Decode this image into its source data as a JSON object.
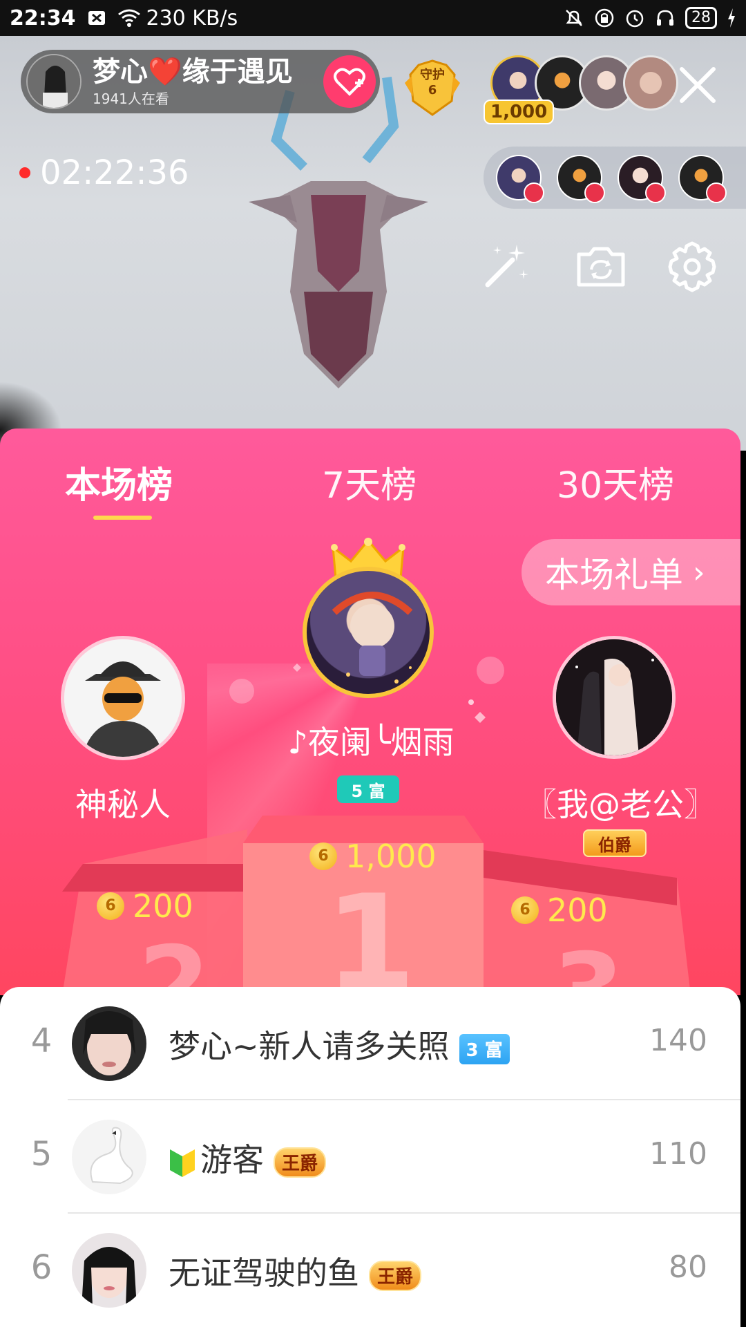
{
  "status_bar": {
    "time": "22:34",
    "network_speed": "230 KB/s",
    "battery": "28"
  },
  "live": {
    "host_name": "梦心❤️缘于遇见",
    "viewers_text": "1941人在看",
    "guard_label": "守护",
    "guard_count": "6",
    "top_viewer_count": "1,000",
    "timer": "02:22:36"
  },
  "ranking": {
    "tabs": [
      {
        "label": "本场榜",
        "active": true
      },
      {
        "label": "7天榜",
        "active": false
      },
      {
        "label": "30天榜",
        "active": false
      }
    ],
    "gift_list_label": "本场礼单",
    "podium": {
      "first": {
        "name": "♪夜阑╰烟雨",
        "badge": "5 富",
        "amount": "1,000",
        "podium_number": "1"
      },
      "second": {
        "name": "神秘人",
        "amount": "200",
        "podium_number": "2"
      },
      "third": {
        "name": "〖我@老公〗",
        "badge": "伯爵",
        "amount": "200",
        "podium_number": "3"
      }
    },
    "coin_symbol": "6",
    "list": [
      {
        "rank": "4",
        "name": "梦心~新人请多关照",
        "badge": "3 富",
        "badge_type": "blue",
        "score": "140"
      },
      {
        "rank": "5",
        "name": "游客",
        "badge": "王爵",
        "badge_type": "gold",
        "score": "110"
      },
      {
        "rank": "6",
        "name": "无证驾驶的鱼",
        "badge": "王爵",
        "badge_type": "gold",
        "score": "80"
      }
    ]
  },
  "colors": {
    "panel_top": "#ff5a9b",
    "panel_bottom": "#ff4660",
    "accent_gold": "#ffe94d",
    "follow": "#ff3c6e"
  }
}
